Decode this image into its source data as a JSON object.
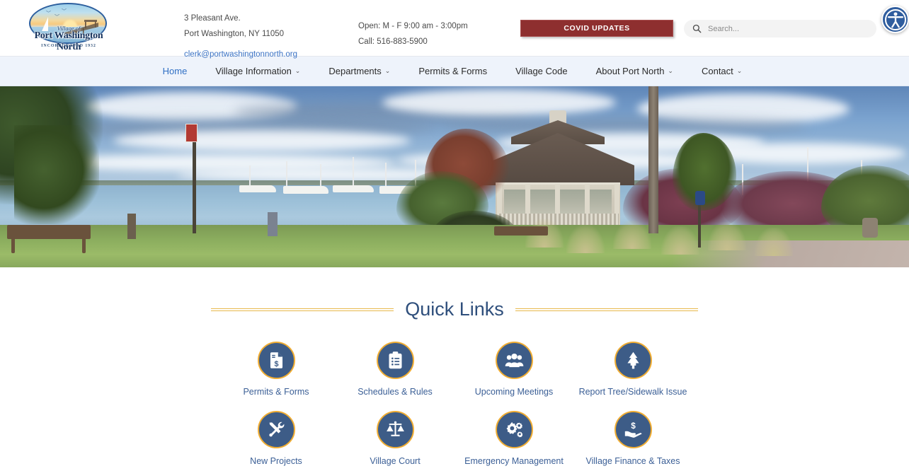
{
  "site": {
    "logo": {
      "village_of": "Village of",
      "name": "Port Washington North",
      "incorporated": "INCORPORATED 1932"
    },
    "contact": {
      "street": "3 Pleasant Ave.",
      "city_state_zip": "Port Washington, NY 11050",
      "email": "clerk@portwashingtonnorth.org",
      "hours": "Open: M - F 9:00 am - 3:00pm",
      "phone": "Call: 516-883-5900"
    },
    "covid_button": "COVID UPDATES",
    "search": {
      "placeholder": "Search...",
      "value": "",
      "icon": "search-icon"
    },
    "accessibility": {
      "icon": "accessibility-person-icon",
      "color": "#2f5d9e"
    }
  },
  "nav": {
    "items": [
      {
        "label": "Home",
        "has_dropdown": false,
        "active": true
      },
      {
        "label": "Village Information",
        "has_dropdown": true,
        "active": false
      },
      {
        "label": "Departments",
        "has_dropdown": true,
        "active": false
      },
      {
        "label": "Permits & Forms",
        "has_dropdown": false,
        "active": false
      },
      {
        "label": "Village Code",
        "has_dropdown": false,
        "active": false
      },
      {
        "label": "About Port North",
        "has_dropdown": true,
        "active": false
      },
      {
        "label": "Contact",
        "has_dropdown": true,
        "active": false
      }
    ],
    "caret_glyph": "⌄"
  },
  "hero": {
    "alt": "Waterfront park with gazebo overlooking marina in Port Washington North"
  },
  "quick_links": {
    "title": "Quick Links",
    "accent_color": "#f0ad33",
    "circle_color": "#3d5c87",
    "label_color": "#3b5f96",
    "items": [
      {
        "label": "Permits & Forms",
        "icon": "document-dollar-icon"
      },
      {
        "label": "Schedules & Rules",
        "icon": "clipboard-list-icon"
      },
      {
        "label": "Upcoming Meetings",
        "icon": "people-group-icon"
      },
      {
        "label": "Report Tree/Sidewalk Issue",
        "icon": "tree-icon"
      },
      {
        "label": "New Projects",
        "icon": "tools-icon"
      },
      {
        "label": "Village Court",
        "icon": "scales-of-justice-icon"
      },
      {
        "label": "Emergency Management",
        "icon": "gears-icon"
      },
      {
        "label": "Village Finance & Taxes",
        "icon": "hand-dollar-icon"
      }
    ]
  }
}
